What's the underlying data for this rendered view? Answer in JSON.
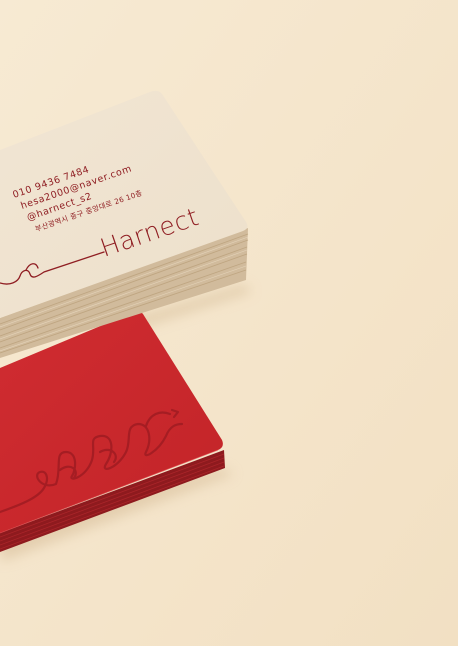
{
  "scene": {
    "background_color": "#f5e6cd",
    "subject": "business-card-mockup"
  },
  "card_front": {
    "color": "#f3e8d8",
    "edge_color": "#cdb79a",
    "text_color": "#8f1d22",
    "phone": "010 9436 7484",
    "email": "hesa2000@naver.com",
    "instagram": "@harnect_s2",
    "address": "부산광역시 중구 중앙대로 26 10층",
    "brand": "Harnect"
  },
  "card_back": {
    "color": "#c8262c",
    "edge_color": "#9a1a1f",
    "emboss_color": "#a81e24",
    "icon": "heart-loop-logo-icon"
  }
}
